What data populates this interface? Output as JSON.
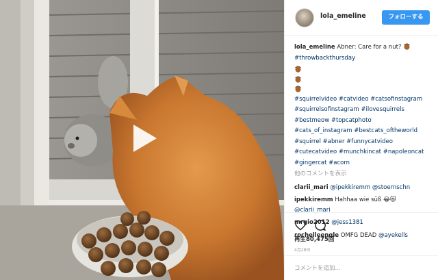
{
  "header": {
    "username": "lola_emeline",
    "follow_label": "フォローする"
  },
  "caption": {
    "username": "lola_emeline",
    "text": "Abner: Care for a nut?",
    "emoji_icon": "acorn-icon",
    "tag_first": "#throwbackthursday",
    "tags": [
      "#squirrelvideo #catvideo #catsofinstagram",
      "#squirrelsofinstagram #ilovesquirrels",
      "#bestmeow #topcatphoto",
      "#cats_of_instagram #bestcats_oftheworld",
      "#squirrel #abner #funnycatvideo",
      "#cutecatvideo #munchkincat #napoleoncat",
      "#gingercat #acorn"
    ]
  },
  "load_more_label": "他のコメントを表示",
  "comments": [
    {
      "user": "clarii_mari",
      "mention1": "@ipekkiremm",
      "mention2": "@stoernschn"
    },
    {
      "user": "ipekkiremm",
      "text": "Hahhaa wie süß 😂😻",
      "mention": "@clarii_mari"
    },
    {
      "user": "mrgio2012",
      "mention": "@jess1381"
    },
    {
      "user": "rochelleengle",
      "text": "OMFG DEAD",
      "mention": "@ayekells"
    }
  ],
  "actions": {
    "like_icon": "heart-icon",
    "comment_icon": "speech-bubble-icon",
    "views": "再生80,475回",
    "date": "4月28日"
  },
  "comment_box": {
    "placeholder": "コメントを追加..."
  },
  "media": {
    "play_icon": "play-icon"
  },
  "colors": {
    "follow_button": "#3897f0",
    "hashtag": "#003569",
    "muted": "#999999"
  }
}
